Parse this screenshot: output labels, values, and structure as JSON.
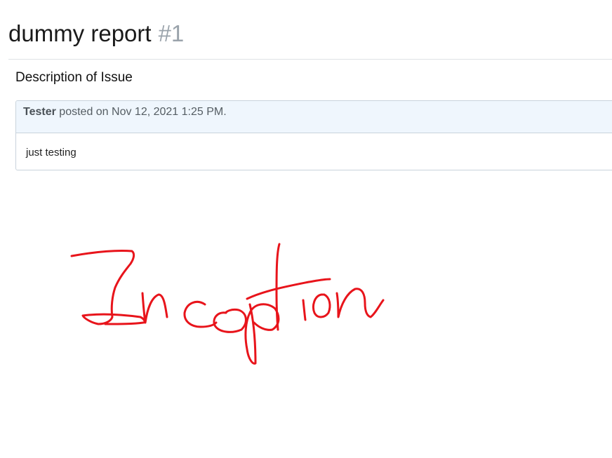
{
  "report": {
    "title": "dummy report",
    "number": "#1"
  },
  "section": {
    "heading": "Description of Issue"
  },
  "comment": {
    "author": "Tester",
    "posted_text": "posted on Nov 12, 2021 1:25 PM.",
    "body": "just testing"
  },
  "annotation": {
    "color": "#e8141b",
    "handwritten_text": "Inception"
  }
}
